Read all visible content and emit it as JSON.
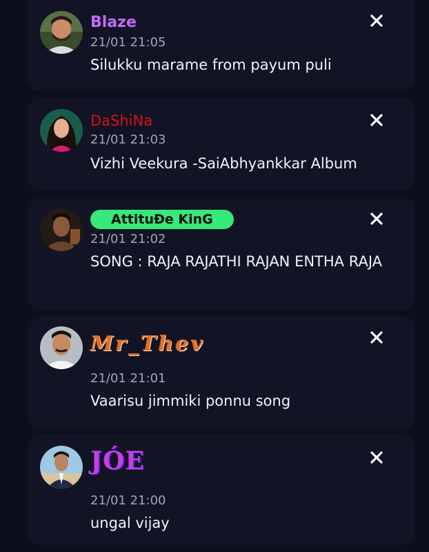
{
  "accent_colors": {
    "background": "#0d0e1b",
    "card": "#121425",
    "blaze_name": "#c26bf2",
    "dashina_name": "#c8141e",
    "attitude_badge": "#37e87a",
    "timestamp": "#a2a5b8",
    "message": "#f2f3f7"
  },
  "requests": [
    {
      "user": "Blaze",
      "time": "21/01 21:05",
      "message": "Silukku marame from payum puli",
      "avatar_icon": "avatar-man-beard-icon",
      "dismiss_icon": "close-icon"
    },
    {
      "user": "DaShiNa",
      "time": "21/01 21:03",
      "message": "Vizhi Veekura -SaiAbhyankkar Album",
      "avatar_icon": "avatar-woman-icon",
      "dismiss_icon": "close-icon"
    },
    {
      "user": "AttituĐe KinG",
      "time": "21/01 21:02",
      "message": "SONG : RAJA RAJATHI RAJAN ENTHA RAJA",
      "avatar_icon": "avatar-man-dark-icon",
      "dismiss_icon": "close-icon"
    },
    {
      "user": "Mr_Thev",
      "time": "21/01 21:01",
      "message": "Vaarisu jimmiki ponnu song",
      "avatar_icon": "avatar-man-mustache-icon",
      "dismiss_icon": "close-icon"
    },
    {
      "user": "JÓE",
      "time": "21/01 21:00",
      "message": "ungal vijay",
      "avatar_icon": "avatar-man-suit-icon",
      "dismiss_icon": "close-icon"
    }
  ]
}
